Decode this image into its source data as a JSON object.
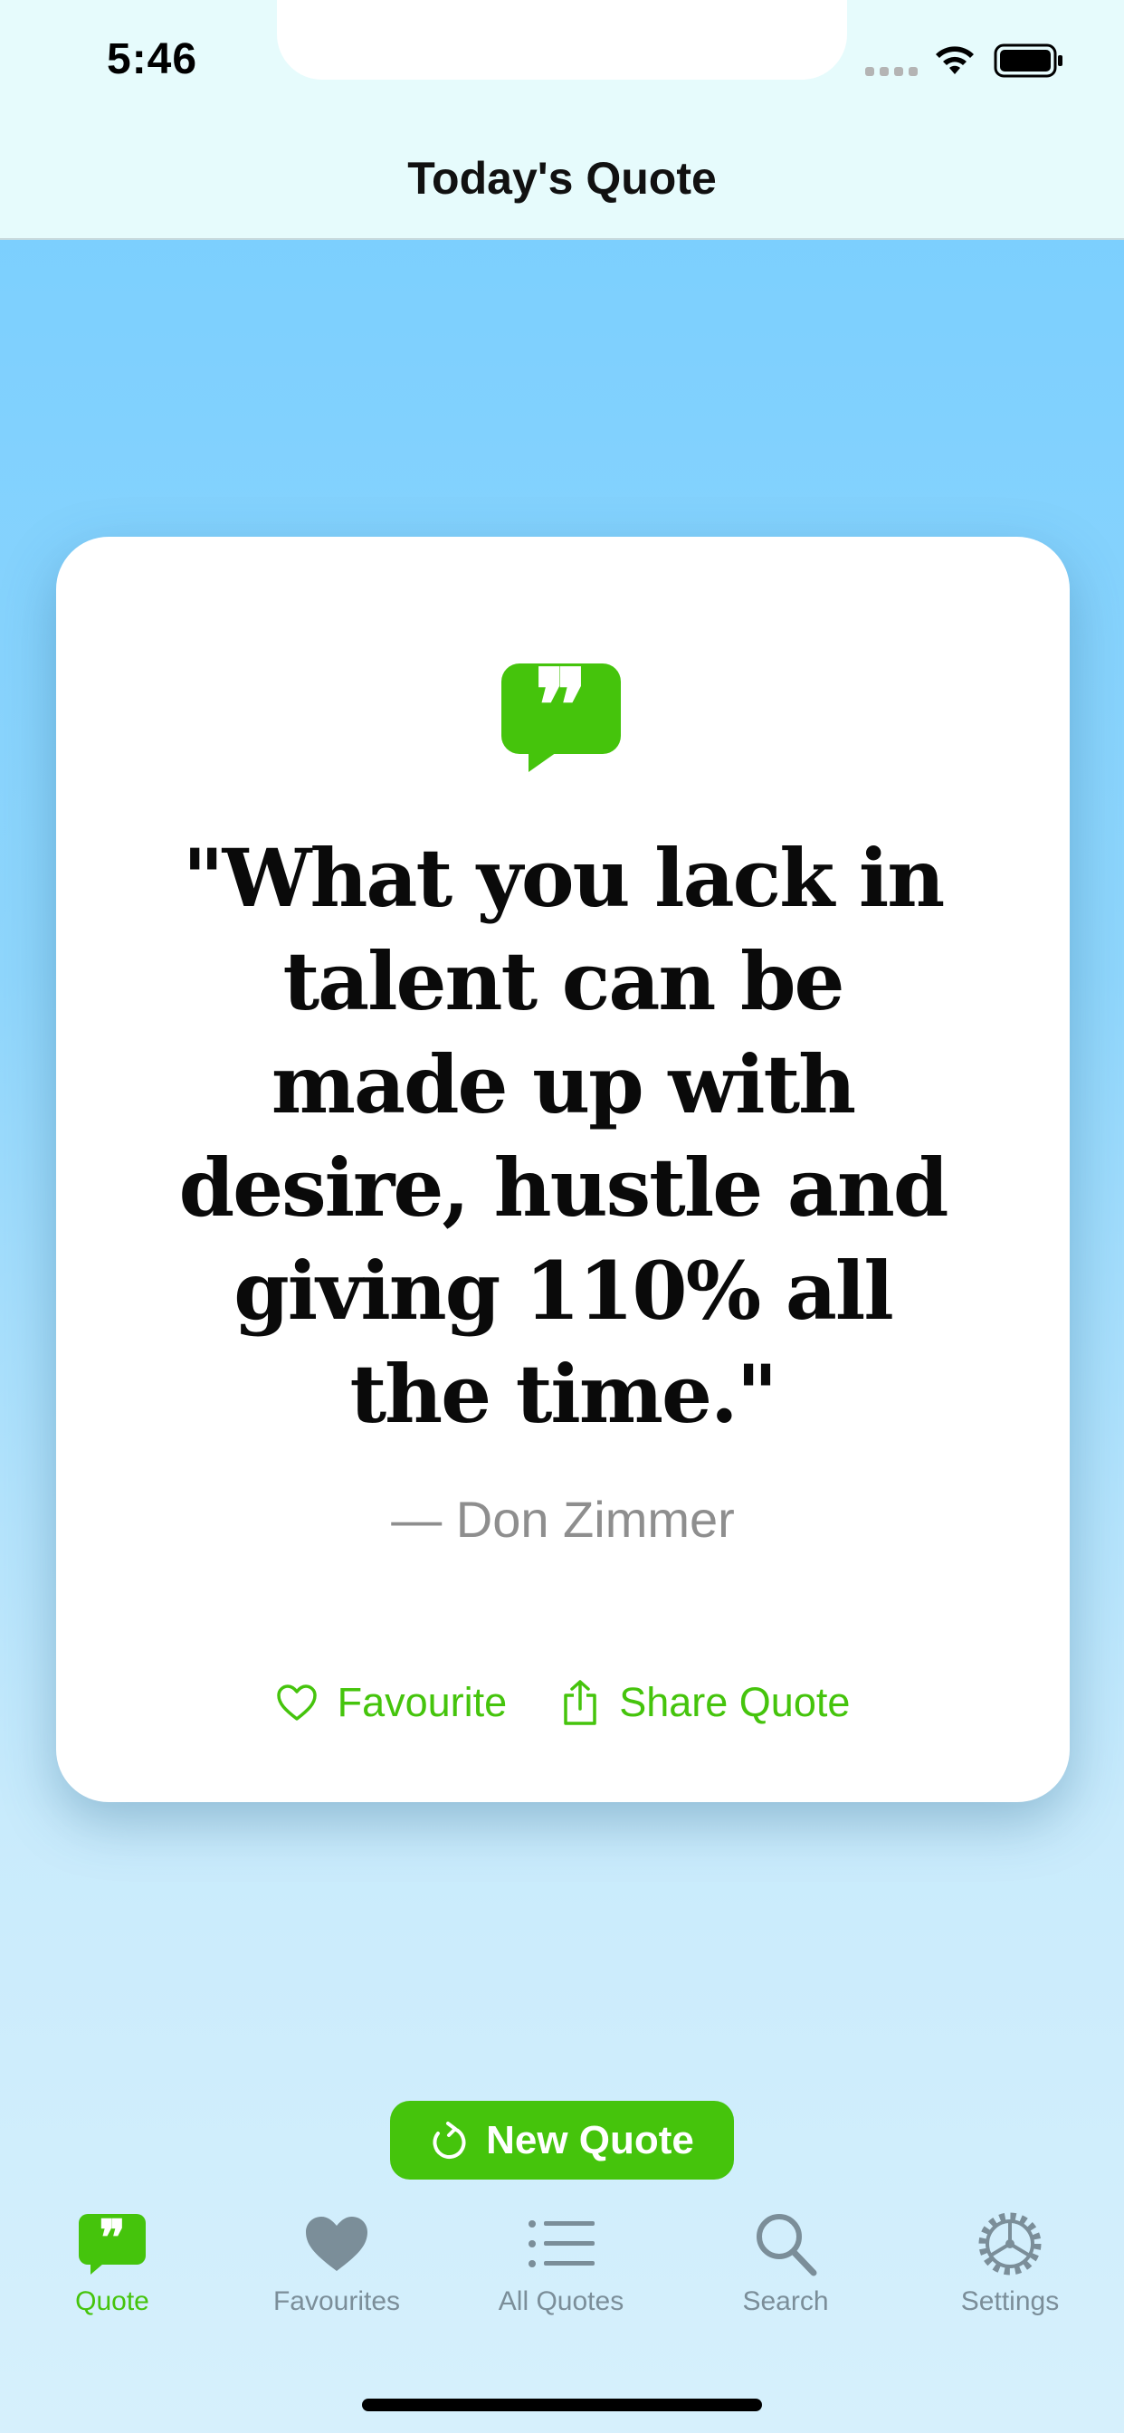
{
  "status_bar": {
    "time": "5:46"
  },
  "nav": {
    "title": "Today's Quote"
  },
  "quote": {
    "text": "\"What you lack in talent can be made up with desire, hustle and giving 110% all the time.\"",
    "author": "— Don Zimmer"
  },
  "actions": {
    "favourite_label": "Favourite",
    "share_label": "Share Quote"
  },
  "new_quote_label": "New Quote",
  "tabs": [
    {
      "label": "Quote",
      "icon": "quote-bubble-icon",
      "active": true
    },
    {
      "label": "Favourites",
      "icon": "heart-icon",
      "active": false
    },
    {
      "label": "All Quotes",
      "icon": "list-icon",
      "active": false
    },
    {
      "label": "Search",
      "icon": "search-icon",
      "active": false
    },
    {
      "label": "Settings",
      "icon": "gear-icon",
      "active": false
    }
  ],
  "colors": {
    "accent": "#45c40c",
    "tab_inactive": "#7b8e99",
    "header_bg": "#e6fbfc",
    "background_top": "#76cdff",
    "background_bottom": "#d6f0fc"
  }
}
